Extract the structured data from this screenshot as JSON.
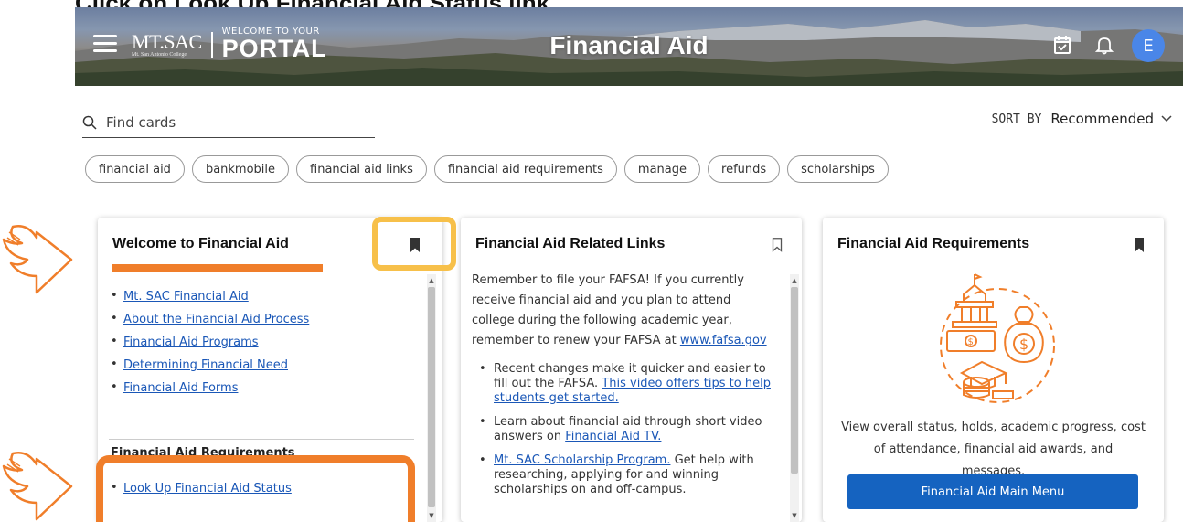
{
  "top_crop_text": "Click on Look Up Financial Aid Status link",
  "header": {
    "logo_mark": "MT.SAC",
    "logo_sub": "Mt. San Antonio College",
    "logo_small": "WELCOME TO YOUR",
    "logo_big": "PORTAL",
    "title": "Financial Aid",
    "avatar_initial": "E"
  },
  "search": {
    "placeholder": "Find cards"
  },
  "sort": {
    "label": "SORT BY",
    "value": "Recommended"
  },
  "chips": [
    "financial aid",
    "bankmobile",
    "financial aid links",
    "financial aid requirements",
    "manage",
    "refunds",
    "scholarships"
  ],
  "card1": {
    "title": "Welcome to Financial Aid",
    "links": [
      "Mt. SAC Financial Aid",
      "About the Financial Aid Process",
      "Financial Aid Programs",
      "Determining Financial Need",
      "Financial Aid Forms"
    ],
    "section_title": "Financial Aid Requirements",
    "section_link": "Look Up Financial Aid Status"
  },
  "card2": {
    "title": "Financial Aid Related Links",
    "intro": "Remember to file your FAFSA!  If you currently receive financial aid and you plan to attend college during the following academic year, remember to renew your FAFSA at ",
    "intro_link": "www.fafsa.gov",
    "b1_text": "Recent changes make it quicker and easier to fill out the FAFSA. ",
    "b1_link": "This video offers tips to help students get started.",
    "b2_text": "Learn about financial aid through short video answers on ",
    "b2_link": "Financial Aid TV.",
    "b3_link": "Mt. SAC Scholarship Program.",
    "b3_text": " Get help with researching, applying for and winning scholarships on and off-campus."
  },
  "card3": {
    "title": "Financial Aid Requirements",
    "description": "View overall status, holds, academic progress, cost of attendance, financial aid awards, and messages.",
    "button": "Financial Aid Main Menu"
  },
  "colors": {
    "accent_orange": "#f07e2a",
    "highlight_yellow": "#f7c04a",
    "button_blue": "#1563c0",
    "link_blue": "#1a57b7",
    "avatar_blue": "#4a86e8"
  },
  "icons": [
    "menu-icon",
    "calendar-check-icon",
    "bell-icon",
    "search-icon",
    "chevron-down-icon",
    "bookmark-icon",
    "arrow-annotation"
  ]
}
